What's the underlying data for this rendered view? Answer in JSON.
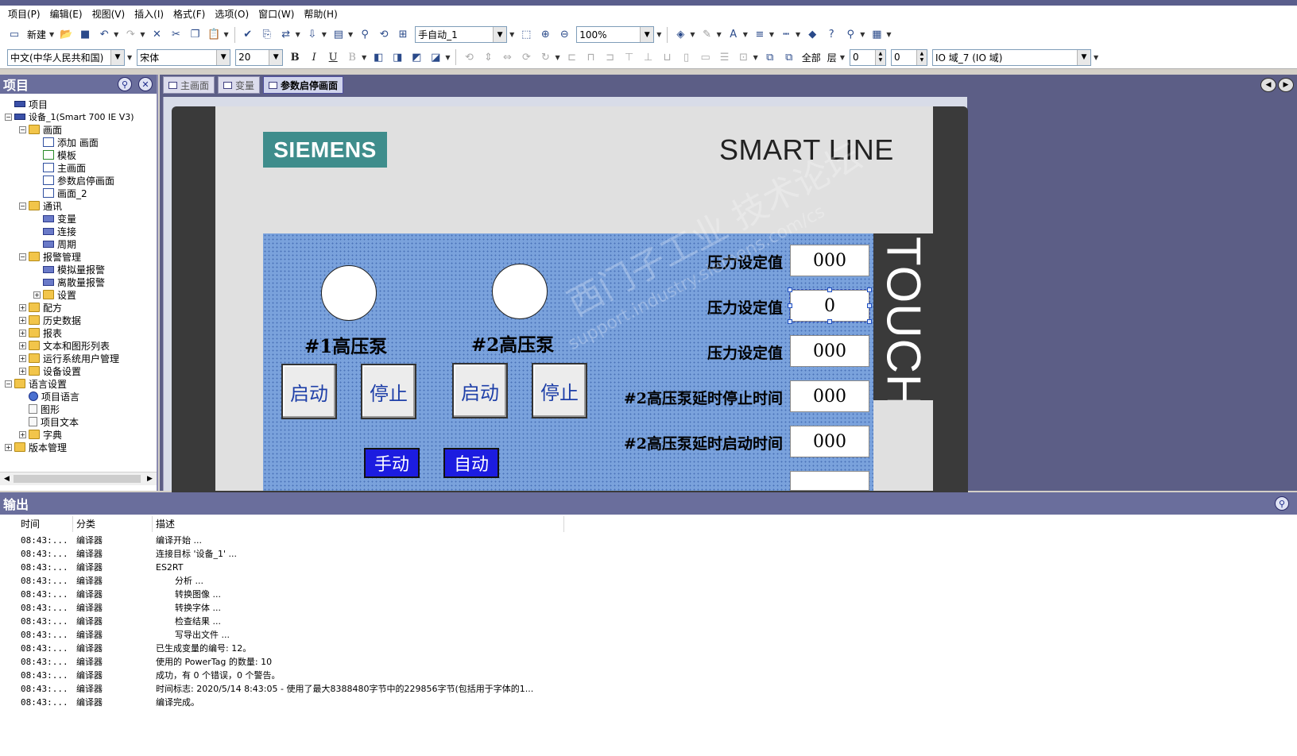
{
  "menu": [
    "项目(P)",
    "编辑(E)",
    "视图(V)",
    "插入(I)",
    "格式(F)",
    "选项(O)",
    "窗口(W)",
    "帮助(H)"
  ],
  "toolbar1": {
    "new_label": "新建",
    "object_combo": "手自动_1",
    "zoom_combo": "100%"
  },
  "toolbar2": {
    "language_combo": "中文(中华人民共和国)",
    "font_combo": "宋体",
    "size_combo": "20",
    "bold": "B",
    "italic": "I",
    "underline": "U",
    "all_label": "全部",
    "layer_label": "层",
    "spin1": "0",
    "spin2": "0",
    "object_select": "IO 域_7 (IO 域)"
  },
  "project_panel": {
    "title": "项目",
    "tree": [
      {
        "label": "项目",
        "level": 0,
        "icon": "project-icon",
        "exp": ""
      },
      {
        "label": "设备_1(Smart 700 IE V3)",
        "level": 0,
        "icon": "device-icon",
        "exp": "-"
      },
      {
        "label": "画面",
        "level": 1,
        "icon": "folder-icon",
        "exp": "-"
      },
      {
        "label": "添加 画面",
        "level": 2,
        "icon": "add-screen-icon",
        "exp": ""
      },
      {
        "label": "模板",
        "level": 2,
        "icon": "template-icon",
        "exp": ""
      },
      {
        "label": "主画面",
        "level": 2,
        "icon": "screen-icon",
        "exp": ""
      },
      {
        "label": "参数启停画面",
        "level": 2,
        "icon": "screen-icon",
        "exp": ""
      },
      {
        "label": "画面_2",
        "level": 2,
        "icon": "screen-icon",
        "exp": ""
      },
      {
        "label": "通讯",
        "level": 1,
        "icon": "folder-icon",
        "exp": "-"
      },
      {
        "label": "变量",
        "level": 2,
        "icon": "tag-icon",
        "exp": ""
      },
      {
        "label": "连接",
        "level": 2,
        "icon": "connection-icon",
        "exp": ""
      },
      {
        "label": "周期",
        "level": 2,
        "icon": "cycle-icon",
        "exp": ""
      },
      {
        "label": "报警管理",
        "level": 1,
        "icon": "folder-icon",
        "exp": "-"
      },
      {
        "label": "模拟量报警",
        "level": 2,
        "icon": "analog-alarm-icon",
        "exp": ""
      },
      {
        "label": "离散量报警",
        "level": 2,
        "icon": "discrete-alarm-icon",
        "exp": ""
      },
      {
        "label": "设置",
        "level": 2,
        "icon": "folder-icon",
        "exp": "+"
      },
      {
        "label": "配方",
        "level": 1,
        "icon": "folder-icon",
        "exp": "+"
      },
      {
        "label": "历史数据",
        "level": 1,
        "icon": "folder-icon",
        "exp": "+"
      },
      {
        "label": "报表",
        "level": 1,
        "icon": "folder-icon",
        "exp": "+"
      },
      {
        "label": "文本和图形列表",
        "level": 1,
        "icon": "folder-icon",
        "exp": "+"
      },
      {
        "label": "运行系统用户管理",
        "level": 1,
        "icon": "folder-icon",
        "exp": "+"
      },
      {
        "label": "设备设置",
        "level": 1,
        "icon": "folder-icon",
        "exp": "+"
      },
      {
        "label": "语言设置",
        "level": 0,
        "icon": "folder-icon",
        "exp": "-"
      },
      {
        "label": "项目语言",
        "level": 1,
        "icon": "globe-icon",
        "exp": ""
      },
      {
        "label": "图形",
        "level": 1,
        "icon": "graphic-icon",
        "exp": ""
      },
      {
        "label": "项目文本",
        "level": 1,
        "icon": "doc-icon",
        "exp": ""
      },
      {
        "label": "字典",
        "level": 1,
        "icon": "folder-icon",
        "exp": "+"
      },
      {
        "label": "版本管理",
        "level": 0,
        "icon": "folder-icon",
        "exp": "+"
      }
    ]
  },
  "tabs": [
    {
      "label": "主画面",
      "active": false
    },
    {
      "label": "变量",
      "active": false
    },
    {
      "label": "参数启停画面",
      "active": true
    }
  ],
  "hmi": {
    "brand": "SIEMENS",
    "product_line": "SMART LINE",
    "touch": "TOUCH",
    "pump1_label": "#1高压泵",
    "pump2_label": "#2高压泵",
    "start": "启动",
    "stop": "停止",
    "manual": "手动",
    "auto": "自动",
    "params": [
      {
        "label": "压力设定值",
        "value": "000"
      },
      {
        "label": "压力设定值",
        "value": "0"
      },
      {
        "label": "压力设定值",
        "value": "000"
      },
      {
        "label": "#2高压泵延时停止时间",
        "value": "000"
      },
      {
        "label": "#2高压泵延时启动时间",
        "value": "000"
      }
    ],
    "watermark": "西门子工业  技术论坛",
    "watermark_url": "support.industry.siemens.com/cs"
  },
  "output": {
    "title": "输出",
    "columns": [
      "时间",
      "分类",
      "描述"
    ],
    "rows": [
      {
        "time": "08:43:...",
        "category": "编译器",
        "desc": "编译开始 ...",
        "indent": false
      },
      {
        "time": "08:43:...",
        "category": "编译器",
        "desc": "连接目标 '设备_1' ...",
        "indent": false
      },
      {
        "time": "08:43:...",
        "category": "编译器",
        "desc": "ES2RT",
        "indent": false
      },
      {
        "time": "08:43:...",
        "category": "编译器",
        "desc": "分析 ...",
        "indent": true
      },
      {
        "time": "08:43:...",
        "category": "编译器",
        "desc": "转换图像 ...",
        "indent": true
      },
      {
        "time": "08:43:...",
        "category": "编译器",
        "desc": "转换字体 ...",
        "indent": true
      },
      {
        "time": "08:43:...",
        "category": "编译器",
        "desc": "检查结果 ...",
        "indent": true
      },
      {
        "time": "08:43:...",
        "category": "编译器",
        "desc": "写导出文件 ...",
        "indent": true
      },
      {
        "time": "08:43:...",
        "category": "编译器",
        "desc": "已生成变量的编号: 12。",
        "indent": false
      },
      {
        "time": "08:43:...",
        "category": "编译器",
        "desc": "使用的 PowerTag 的数量: 10",
        "indent": false
      },
      {
        "time": "08:43:...",
        "category": "编译器",
        "desc": "成功，有 0 个错误，0 个警告。",
        "indent": false
      },
      {
        "time": "08:43:...",
        "category": "编译器",
        "desc": "时间标志: 2020/5/14 8:43:05 - 使用了最大8388480字节中的229856字节(包括用于字体的1...",
        "indent": false
      },
      {
        "time": "08:43:...",
        "category": "编译器",
        "desc": "编译完成。",
        "indent": false
      }
    ]
  }
}
